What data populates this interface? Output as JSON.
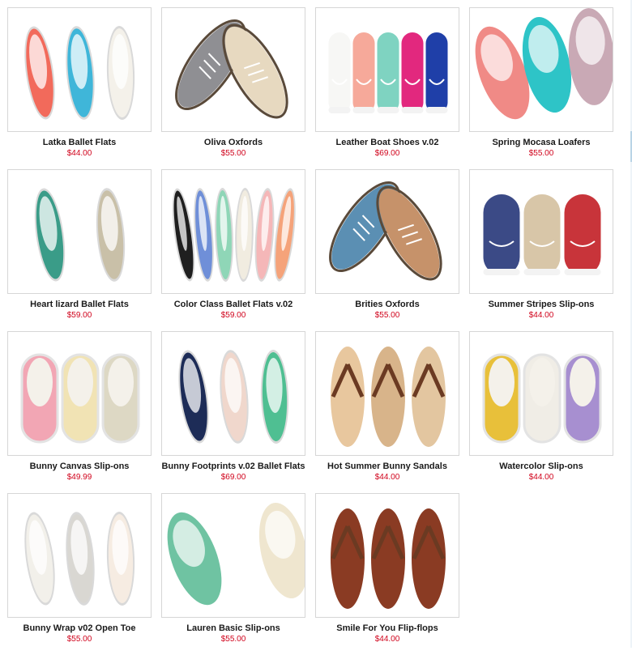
{
  "products": [
    {
      "name": "Latka Ballet Flats",
      "price": "$44.00",
      "kind": "flat",
      "colors": [
        "#f26a5b",
        "#3fb6d9",
        "#f4f1ea"
      ]
    },
    {
      "name": "Oliva Oxfords",
      "price": "$55.00",
      "kind": "oxford",
      "colors": [
        "#8f8f93",
        "#e7d9c0"
      ]
    },
    {
      "name": "Leather Boat Shoes v.02",
      "price": "$69.00",
      "kind": "boat",
      "colors": [
        "#f7f7f5",
        "#f6a99a",
        "#7fd3c1",
        "#e2287e",
        "#1f3fa8"
      ]
    },
    {
      "name": "Spring Mocasa Loafers",
      "price": "$55.00",
      "kind": "loafer",
      "colors": [
        "#f08a86",
        "#2ec4c7",
        "#c9a9b5"
      ]
    },
    {
      "name": "Heart lizard Ballet Flats",
      "price": "$59.00",
      "kind": "flat",
      "colors": [
        "#3a9c88",
        "#c9c0a8"
      ]
    },
    {
      "name": "Color Class Ballet Flats v.02",
      "price": "$59.00",
      "kind": "flat",
      "colors": [
        "#1f1f1f",
        "#6f8fd8",
        "#8fd6b7",
        "#f1ece0",
        "#f5b7b8",
        "#f5a37a"
      ]
    },
    {
      "name": "Brities Oxfords",
      "price": "$55.00",
      "kind": "oxford",
      "colors": [
        "#5b8fb3",
        "#c6926a"
      ]
    },
    {
      "name": "Summer Stripes Slip-ons",
      "price": "$44.00",
      "kind": "boat",
      "colors": [
        "#3b4a86",
        "#d8c6a8",
        "#c8343a"
      ]
    },
    {
      "name": "Bunny Canvas Slip-ons",
      "price": "$49.99",
      "kind": "slipon",
      "colors": [
        "#f2a6b4",
        "#f1e3b4",
        "#ddd8c4"
      ]
    },
    {
      "name": "Bunny Footprints v.02 Ballet Flats",
      "price": "$69.00",
      "kind": "flat",
      "colors": [
        "#1d2c57",
        "#f0d7cc",
        "#4fbf92"
      ]
    },
    {
      "name": "Hot Summer Bunny Sandals",
      "price": "$44.00",
      "kind": "sandal",
      "colors": [
        "#e8c79e",
        "#d8b48a",
        "#e3c6a0"
      ]
    },
    {
      "name": "Watercolor Slip-ons",
      "price": "$44.00",
      "kind": "slipon",
      "colors": [
        "#e8c03a",
        "#f0ede6",
        "#a78fd0"
      ]
    },
    {
      "name": "Bunny Wrap v02 Open Toe",
      "price": "$55.00",
      "kind": "flat",
      "colors": [
        "#f2f0ea",
        "#d9d7d2",
        "#f6ece2"
      ]
    },
    {
      "name": "Lauren Basic Slip-ons",
      "price": "$55.00",
      "kind": "loafer",
      "colors": [
        "#6fc3a2",
        "#efe6cf"
      ]
    },
    {
      "name": "Smile For You Flip-flops",
      "price": "$44.00",
      "kind": "sandal",
      "colors": [
        "#8a3b23",
        "#8a3b23",
        "#8a3b23"
      ]
    }
  ]
}
